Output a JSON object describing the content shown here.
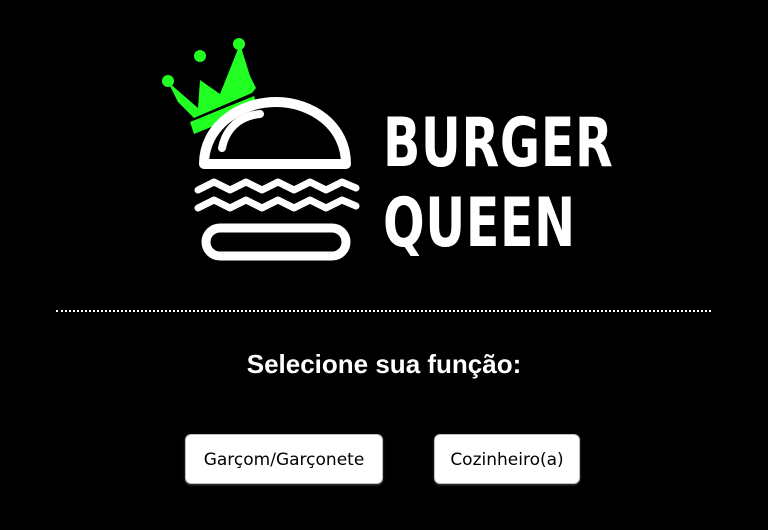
{
  "brand": {
    "line1": "BURGER",
    "line2": "QUEEN"
  },
  "icons": {
    "logo": "burger-crown-icon"
  },
  "colors": {
    "background": "#000000",
    "crown": "#22ff22",
    "text": "#ffffff"
  },
  "main": {
    "prompt": "Selecione sua função:",
    "buttons": [
      {
        "label": "Garçom/Garçonete"
      },
      {
        "label": "Cozinheiro(a)"
      }
    ]
  }
}
